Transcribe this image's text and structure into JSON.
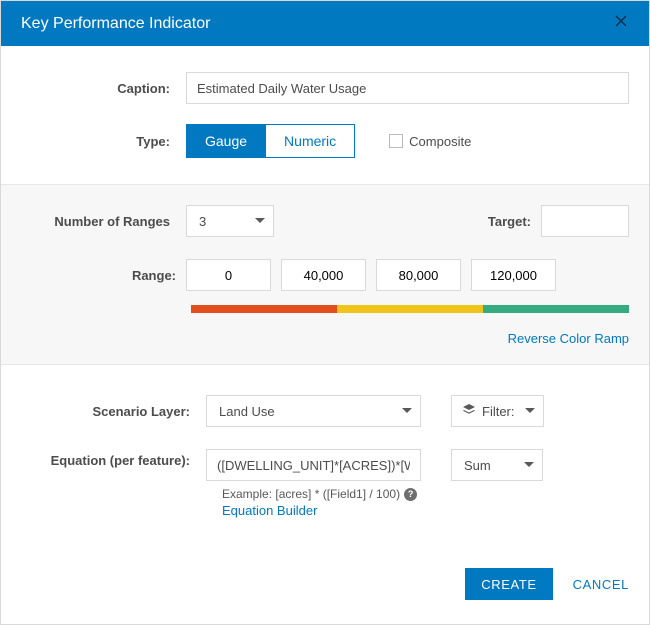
{
  "header": {
    "title": "Key Performance Indicator"
  },
  "form": {
    "caption_label": "Caption:",
    "caption_value": "Estimated Daily Water Usage",
    "type_label": "Type:",
    "type_options": {
      "gauge": "Gauge",
      "numeric": "Numeric"
    },
    "type_selected": "gauge",
    "composite_label": "Composite",
    "composite_checked": false
  },
  "gauge": {
    "num_ranges_label": "Number of Ranges",
    "num_ranges_value": "3",
    "target_label": "Target:",
    "target_value": "",
    "range_label": "Range:",
    "range_values": [
      "0",
      "40,000",
      "80,000",
      "120,000"
    ],
    "ramp_colors": [
      "#e04f1d",
      "#f0c419",
      "#35ac7f"
    ],
    "reverse_label": "Reverse Color Ramp"
  },
  "scenario": {
    "layer_label": "Scenario Layer:",
    "layer_value": "Land Use",
    "filter_label": "Filter:"
  },
  "equation": {
    "label": "Equation (per feature):",
    "value": "([DWELLING_UNIT]*[ACRES])*[WATER_RATE]",
    "agg_value": "Sum",
    "example_text": "Example: [acres] * ([Field1] / 100)",
    "builder_label": "Equation Builder"
  },
  "footer": {
    "create": "CREATE",
    "cancel": "CANCEL"
  }
}
